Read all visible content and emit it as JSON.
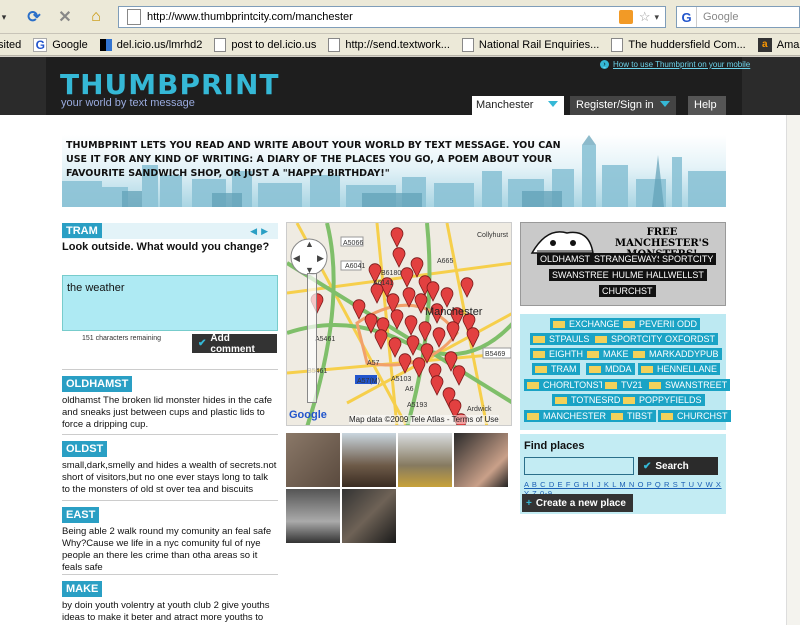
{
  "browser": {
    "url": "http://www.thumbprintcity.com/manchester",
    "search_placeholder": "Google",
    "bookmarks": [
      {
        "label": "sited",
        "icon": "none"
      },
      {
        "label": "Google",
        "icon": "google"
      },
      {
        "label": "del.icio.us/lmrhd2",
        "icon": "delicious"
      },
      {
        "label": "post to del.icio.us",
        "icon": "page"
      },
      {
        "label": "http://send.textwork...",
        "icon": "page"
      },
      {
        "label": "National Rail Enquiries...",
        "icon": "page"
      },
      {
        "label": "The huddersfield Com...",
        "icon": "page"
      },
      {
        "label": "Amazon.co.uk: low pr...",
        "icon": "amazon"
      }
    ]
  },
  "header": {
    "logo": "THUMBPRINT",
    "tagline": "your world by text message",
    "mobile_link": "How to use Thumbprint on your mobile",
    "city": "Manchester",
    "register": "Register/Sign in",
    "help": "Help"
  },
  "banner": {
    "text": "THUMBPRINT LETS YOU READ AND WRITE ABOUT YOUR WORLD BY TEXT MESSAGE. YOU CAN USE IT FOR ANY KIND OF WRITING: A DIARY OF THE PLACES YOU GO, A POEM ABOUT YOUR FAVOURITE SANDWICH SHOP, OR JUST A \"HAPPY BIRTHDAY!\""
  },
  "prompt": {
    "tag": "TRAM",
    "question": "Look outside. What would you change?",
    "comment_value": "the weather",
    "chars_remaining": "151 characters remaining",
    "add_comment": "Add comment"
  },
  "entries": [
    {
      "tag": "OLDHAMST",
      "text": "oldhamst The broken lid monster hides in the cafe and sneaks just between cups and plastic lids to force a dripping cup."
    },
    {
      "tag": "OLDST",
      "text": "small,dark,smelly and hides a wealth of secrets.not short of visitors,but no one ever stays long to talk to the monsters of old st over tea and biscuits"
    },
    {
      "tag": "EAST",
      "text": "Being able 2 walk round my comunity an feal safe Why?Cause we life in a nyc comunity ful of nye people an there les crime than otha areas so it feals safe"
    },
    {
      "tag": "MAKE",
      "text": "by doin youth volentry at youth club 2 give youths ideas to make it beter and atract more youths to get"
    }
  ],
  "map": {
    "credit": "Map data ©2009 Tele Atlas",
    "terms": "Terms of Use",
    "google": "Google",
    "labels": [
      "Collyhurst",
      "Manchester",
      "Ardwick",
      "A5066",
      "A6041",
      "A6141",
      "B6180",
      "A665",
      "A5461",
      "A57",
      "A57(M)",
      "A5103",
      "A6",
      "B5469",
      "A5193",
      "B5461"
    ]
  },
  "monsters": {
    "title": "FREE MANCHESTER'S MONSTERS!",
    "tags": [
      "OLDHAMST",
      "STRANGEWAYS",
      "SPORTCITY",
      "SWANSTREET",
      "HULME",
      "HALLWELLST",
      "CHURCHST"
    ]
  },
  "places": {
    "tags": [
      "EXCHANGE",
      "PEVERIL",
      "ODD",
      "STPAULS",
      "SPORTCITY",
      "OXFORDST",
      "EIGHTH",
      "MAKE",
      "MARKADDYPUB",
      "TRAM",
      "MDDA",
      "HENNELLANE",
      "CHORLTONST",
      "TV21",
      "SWANSTREET",
      "TOTNESRD",
      "POPPYFIELDS",
      "MANCHESTER",
      "TIBST",
      "CHURCHST"
    ]
  },
  "find": {
    "title": "Find places",
    "search": "Search",
    "letters": "A B C D E F G H I J K L M N O P Q R S T U V W X Y Z 0-9",
    "create": "Create a new place"
  },
  "colors": {
    "accent": "#2a9fc4",
    "header_bg": "#1e1e1e",
    "place_bg": "#bde9f2"
  }
}
